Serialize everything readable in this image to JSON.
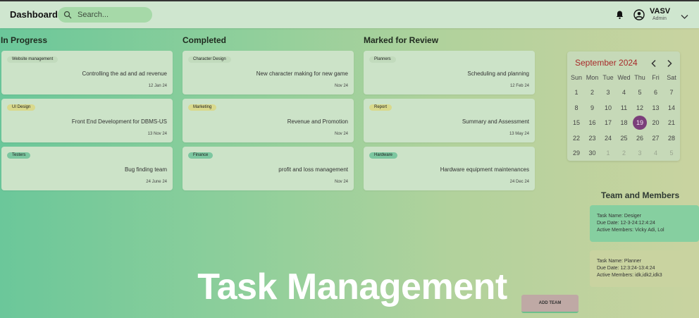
{
  "header": {
    "brand": "Dashboard",
    "search_placeholder": "Search...",
    "user_name": "VASV",
    "user_role": "Admin"
  },
  "columns": [
    {
      "title": "In Progress",
      "cards": [
        {
          "tag": "Website management",
          "tag_color": "#c2dbbd",
          "title": "Controlling the ad and ad revenue",
          "date": "12 Jan 24"
        },
        {
          "tag": "UI Design",
          "tag_color": "#d9d98c",
          "title": "Front End Development for DBMS-US",
          "date": "13 Nov 24"
        },
        {
          "tag": "Testers",
          "tag_color": "#7cc7a0",
          "title": "Bug finding team",
          "date": "24 June 24"
        }
      ]
    },
    {
      "title": "Completed",
      "cards": [
        {
          "tag": "Character Design",
          "tag_color": "#c2dbbd",
          "title": "New character making for new game",
          "date": "Nov 24"
        },
        {
          "tag": "Marketing",
          "tag_color": "#d9d98c",
          "title": "Revenue and Promotion",
          "date": "Nov 24"
        },
        {
          "tag": "Finance",
          "tag_color": "#7cc7a0",
          "title": "profit and loss management",
          "date": "Nov 24"
        }
      ]
    },
    {
      "title": "Marked for Review",
      "cards": [
        {
          "tag": "Planners",
          "tag_color": "#c2dbbd",
          "title": "Scheduling and planning",
          "date": "12 Feb 24"
        },
        {
          "tag": "Report",
          "tag_color": "#d9d98c",
          "title": "Summary and Assessment",
          "date": "13 May 24"
        },
        {
          "tag": "Hardware",
          "tag_color": "#7cc7a0",
          "title": "Hardware equipment maintenances",
          "date": "24 Dec 24"
        }
      ]
    }
  ],
  "calendar": {
    "month_label": "September 2024",
    "weekdays": [
      "Sun",
      "Mon",
      "Tue",
      "Wed",
      "Thu",
      "Fri",
      "Sat"
    ],
    "weeks": [
      [
        "1",
        "2",
        "3",
        "4",
        "5",
        "6",
        "7"
      ],
      [
        "8",
        "9",
        "10",
        "11",
        "12",
        "13",
        "14"
      ],
      [
        "15",
        "16",
        "17",
        "18",
        "19",
        "20",
        "21"
      ],
      [
        "22",
        "23",
        "24",
        "25",
        "26",
        "27",
        "28"
      ],
      [
        "29",
        "30",
        "1",
        "2",
        "3",
        "4",
        "5"
      ]
    ],
    "selected_day": "19",
    "accent_color": "#7b3f7a"
  },
  "team": {
    "heading": "Team and Members",
    "items": [
      {
        "task_name": "Task Name: Desiger",
        "due_date": "Due Date: 12-3-24:12:4:24",
        "members": "Active Members: Vicky Adi, Lol",
        "bg": "#86cfa0"
      },
      {
        "task_name": "Task Name: Planner",
        "due_date": "Due Date: 12:3:24-13:4:24",
        "members": "Active Members: idk,idk2,idk3",
        "bg": "#c9d3a0"
      }
    ]
  },
  "add_team_label": "ADD TEAM",
  "overlay_title": "Task Management"
}
